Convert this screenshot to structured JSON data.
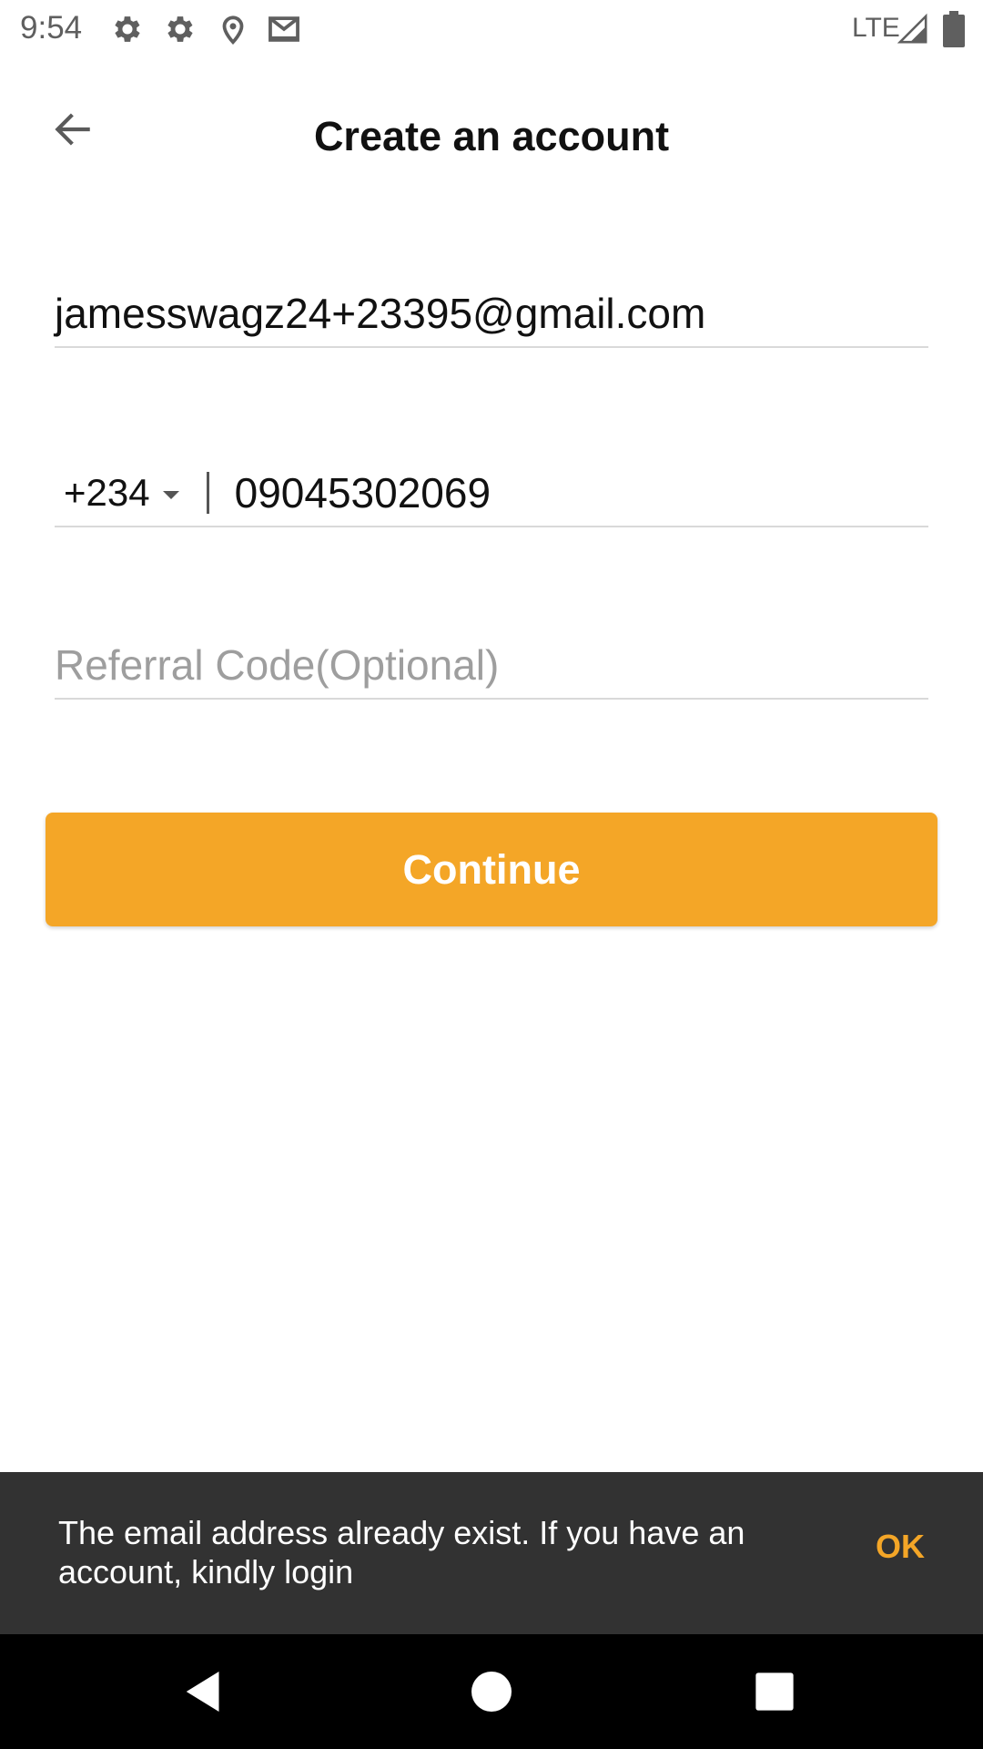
{
  "status_bar": {
    "time": "9:54",
    "network": "LTE",
    "icons": [
      "settings-icon",
      "settings-icon",
      "location-icon",
      "gmail-icon",
      "signal-icon",
      "battery-icon"
    ]
  },
  "header": {
    "title": "Create an account",
    "back_icon": "arrow-back-icon"
  },
  "form": {
    "email": {
      "value": "jamesswagz24+23395@gmail.com"
    },
    "phone": {
      "country_code": "+234",
      "number": "09045302069"
    },
    "referral": {
      "placeholder": "Referral Code(Optional)",
      "value": ""
    }
  },
  "continue_button": {
    "label": "Continue"
  },
  "snackbar": {
    "message": "The email address already exist. If you have an account, kindly login",
    "action": "OK"
  },
  "nav_bar": {
    "buttons": [
      "back-triangle-icon",
      "home-circle-icon",
      "recents-square-icon"
    ]
  },
  "colors": {
    "accent": "#f4a627",
    "snackbar_bg": "#323232",
    "nav_bg": "#000000"
  }
}
